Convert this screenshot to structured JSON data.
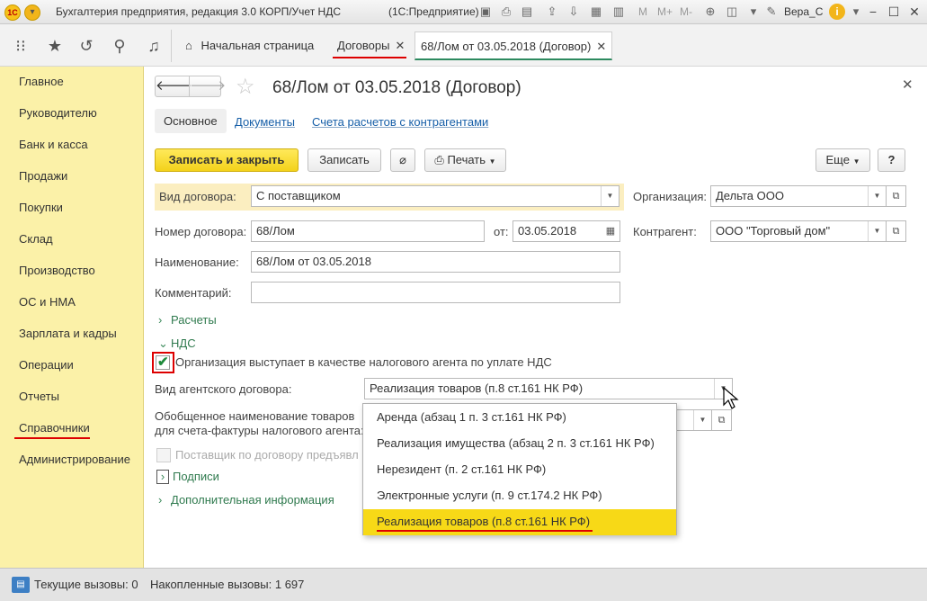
{
  "window": {
    "title": "Бухгалтерия предприятия, редакция 3.0 КОРП/Учет НДС",
    "app": "(1С:Предприятие)",
    "logo_text": "1С",
    "m_labels": [
      "M",
      "M+",
      "M-"
    ],
    "user": "Вера_С"
  },
  "tabs": {
    "home": "Начальная страница",
    "contracts": "Договоры",
    "current": "68/Лом от 03.05.2018 (Договор)"
  },
  "sidebar": {
    "items": [
      "Главное",
      "Руководителю",
      "Банк и касса",
      "Продажи",
      "Покупки",
      "Склад",
      "Производство",
      "ОС и НМА",
      "Зарплата и кадры",
      "Операции",
      "Отчеты",
      "Справочники",
      "Администрирование"
    ]
  },
  "form": {
    "title": "68/Лом от 03.05.2018 (Договор)",
    "subtabs": [
      "Основное",
      "Документы",
      "Счета расчетов с контрагентами"
    ],
    "buttons": {
      "save_close": "Записать и закрыть",
      "save": "Записать",
      "print": "Печать",
      "more": "Еще",
      "help": "?"
    },
    "fields": {
      "contract_type_label": "Вид договора:",
      "contract_type_value": "С поставщиком",
      "org_label": "Организация:",
      "org_value": "Дельта ООО",
      "number_label": "Номер договора:",
      "number_value": "68/Лом",
      "date_label": "от:",
      "date_value": "03.05.2018",
      "counterparty_label": "Контрагент:",
      "counterparty_value": "ООО \"Торговый дом\"",
      "name_label": "Наименование:",
      "name_value": "68/Лом от 03.05.2018",
      "comment_label": "Комментарий:",
      "comment_value": ""
    },
    "groups": {
      "settlements": "Расчеты",
      "vat": "НДС",
      "signatures": "Подписи",
      "additional": "Дополнительная информация"
    },
    "vat": {
      "tax_agent_label": "Организация выступает в качестве налогового агента по уплате НДС",
      "tax_agent_checked": true,
      "agent_contract_label": "Вид агентского договора:",
      "agent_contract_value": "Реализация товаров (п.8 ст.161 НК РФ)",
      "goods_name_label_1": "Обобщенное наименование товаров",
      "goods_name_label_2": "для счета-фактуры налогового агента:",
      "supplier_label": "Поставщик по договору предъявл"
    },
    "dropdown_options": [
      "Аренда (абзац 1 п. 3 ст.161 НК РФ)",
      "Реализация имущества (абзац 2 п. 3 ст.161 НК РФ)",
      "Нерезидент (п. 2 ст.161 НК РФ)",
      "Электронные услуги (п. 9 ст.174.2 НК РФ)",
      "Реализация товаров (п.8 ст.161 НК РФ)"
    ]
  },
  "status": {
    "current_calls": "Текущие вызовы: 0",
    "accumulated_calls": "Накопленные вызовы: 1 697"
  },
  "colors": {
    "sidebar_bg": "#fbf1a8",
    "primary_button": "#f3d21b",
    "selected_option": "#f7d917",
    "highlight_row": "#fbeec0",
    "link": "#175fa8",
    "group_green": "#2f7a4e",
    "annotation_red": "#dd0000"
  }
}
